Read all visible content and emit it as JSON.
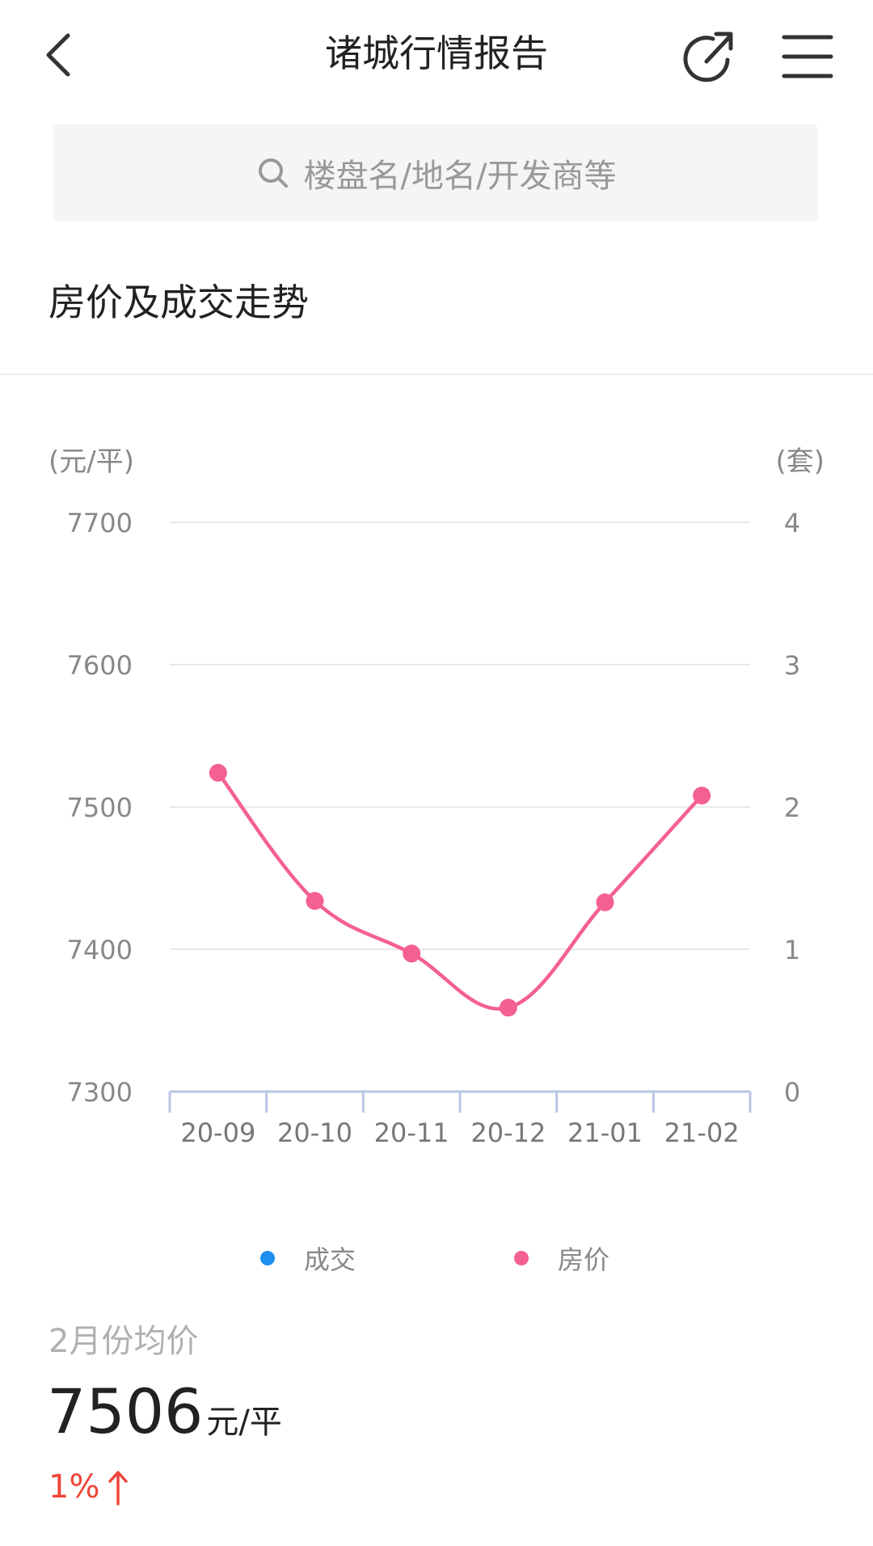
{
  "header": {
    "title": "诸城行情报告",
    "back_icon": "chevron-left-icon",
    "share_icon": "share-icon",
    "menu_icon": "menu-icon"
  },
  "search": {
    "placeholder": "楼盘名/地名/开发商等",
    "icon": "search-icon"
  },
  "section": {
    "title": "房价及成交走势"
  },
  "chart_data": {
    "type": "line",
    "left_axis_unit": "(元/平)",
    "right_axis_unit": "(套)",
    "categories": [
      "20-09",
      "20-10",
      "20-11",
      "20-12",
      "21-01",
      "21-02"
    ],
    "left_ticks": [
      "7700",
      "7600",
      "7500",
      "7400",
      "7300"
    ],
    "right_ticks": [
      "4",
      "3",
      "2",
      "1",
      "0"
    ],
    "ylim_left": [
      7300,
      7700
    ],
    "ylim_right": [
      0,
      4
    ],
    "grid": true,
    "series": [
      {
        "name": "房价",
        "axis": "left",
        "color": "#f4608f",
        "values": [
          7524,
          7434,
          7397,
          7359,
          7433,
          7508
        ]
      },
      {
        "name": "成交",
        "axis": "right",
        "color": "#1d8ff0",
        "values": []
      }
    ]
  },
  "legend": {
    "items": [
      {
        "label": "成交",
        "color": "#1d8ff0"
      },
      {
        "label": "房价",
        "color": "#f4608f"
      }
    ]
  },
  "summary": {
    "avg_label": "2月份均价",
    "avg_value": "7506",
    "avg_unit": "元/平",
    "change": "1%",
    "change_direction": "up",
    "change_color": "#f0453a"
  }
}
